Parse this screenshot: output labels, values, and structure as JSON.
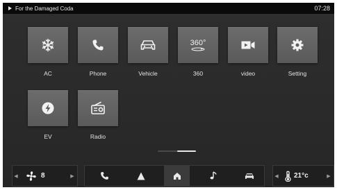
{
  "statusbar": {
    "media_title": "For the Damaged Coda",
    "time": "07:28"
  },
  "apps": [
    {
      "label": "AC",
      "icon": "snowflake-icon"
    },
    {
      "label": "Phone",
      "icon": "phone-icon"
    },
    {
      "label": "Vehicle",
      "icon": "car-icon"
    },
    {
      "label": "360",
      "icon": "360-view-icon",
      "icon_text": "360°"
    },
    {
      "label": "video",
      "icon": "video-camera-icon"
    },
    {
      "label": "Setting",
      "icon": "gear-icon"
    },
    {
      "label": "EV",
      "icon": "lightning-icon"
    },
    {
      "label": "Radio",
      "icon": "radio-icon"
    }
  ],
  "pager": {
    "page_count": 2,
    "active_page": 2
  },
  "dock": {
    "fan": {
      "value": "8",
      "left_arrow": "◀",
      "right_arrow": "▶"
    },
    "nav_items": [
      "phone-icon",
      "navigation-arrow-icon",
      "home-icon",
      "music-note-icon",
      "car-icon"
    ],
    "active_nav": "home-icon",
    "temperature": {
      "value": "21°c",
      "left_arrow": "◀",
      "right_arrow": "▶"
    }
  },
  "colors": {
    "background": "#2a2a2a",
    "tile": "#636363",
    "statusbar": "#0a0a0a",
    "dock": "#1f1f1f"
  }
}
